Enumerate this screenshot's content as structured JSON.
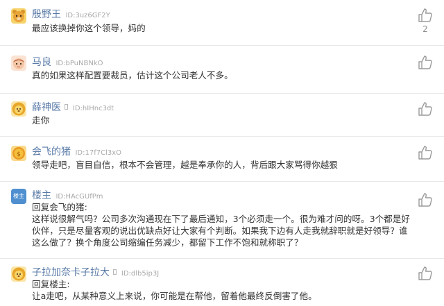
{
  "comments": [
    {
      "username": "殷野王",
      "id_label": "ID:3uz6GF2Y",
      "lines": [
        "最应该换掉你这个领导，妈的"
      ],
      "likes": "2",
      "avatar": "bear-face-avatar",
      "avatar_color": "#f3b73a"
    },
    {
      "username": "马良",
      "id_label": "ID:bPuNBNkO",
      "lines": [
        "真的如果这样配置要裁员，估计这个公司老人不多。"
      ],
      "likes": "",
      "avatar": "girl-face-avatar",
      "avatar_color": "#f6c6a8"
    },
    {
      "username": "薛神医",
      "id_label": "ID:hIHnc3dt",
      "lines": [
        "走你"
      ],
      "likes": "",
      "avatar": "lion-face-avatar",
      "avatar_color": "#f2c23c"
    },
    {
      "username": "会飞的猪",
      "id_label": "ID:17f7Cl3xO",
      "lines": [
        "领导走吧，盲目自信，根本不会管理，越是奉承你的人，背后跟大家骂得你越狠"
      ],
      "likes": "",
      "avatar": "coin-face-avatar",
      "avatar_color": "#e9a22d"
    },
    {
      "username": "楼主",
      "id_label": "ID:HAcGUfPm",
      "avatar_text": "楼主",
      "lines": [
        "回复会飞的猪:",
        "这样说很解气吗？公司多次沟通现在下了最后通知，3个必须走一个。很为难才问的呀。3个都是好",
        "伙伴，只是尽量客观的说出优缺点好让大家有个判断。如果我下边有人走我就辞职就是好领导？谁",
        "这么做了？换个角度公司缩编任务减少，都留下工作不饱和就称职了？"
      ],
      "likes": "",
      "avatar": "owner-badge-avatar",
      "avatar_color": "#4f8fd0"
    },
    {
      "username": "子拉加奈卡子拉大",
      "id_label": "ID:dlb5ip3J",
      "lines": [
        "回复楼主:",
        "让a走吧，从某种意义上来说，你可能是在帮他，留着他最终反倒害了他。"
      ],
      "likes": "",
      "avatar": "lion-face-avatar",
      "avatar_color": "#f2c23c"
    }
  ]
}
